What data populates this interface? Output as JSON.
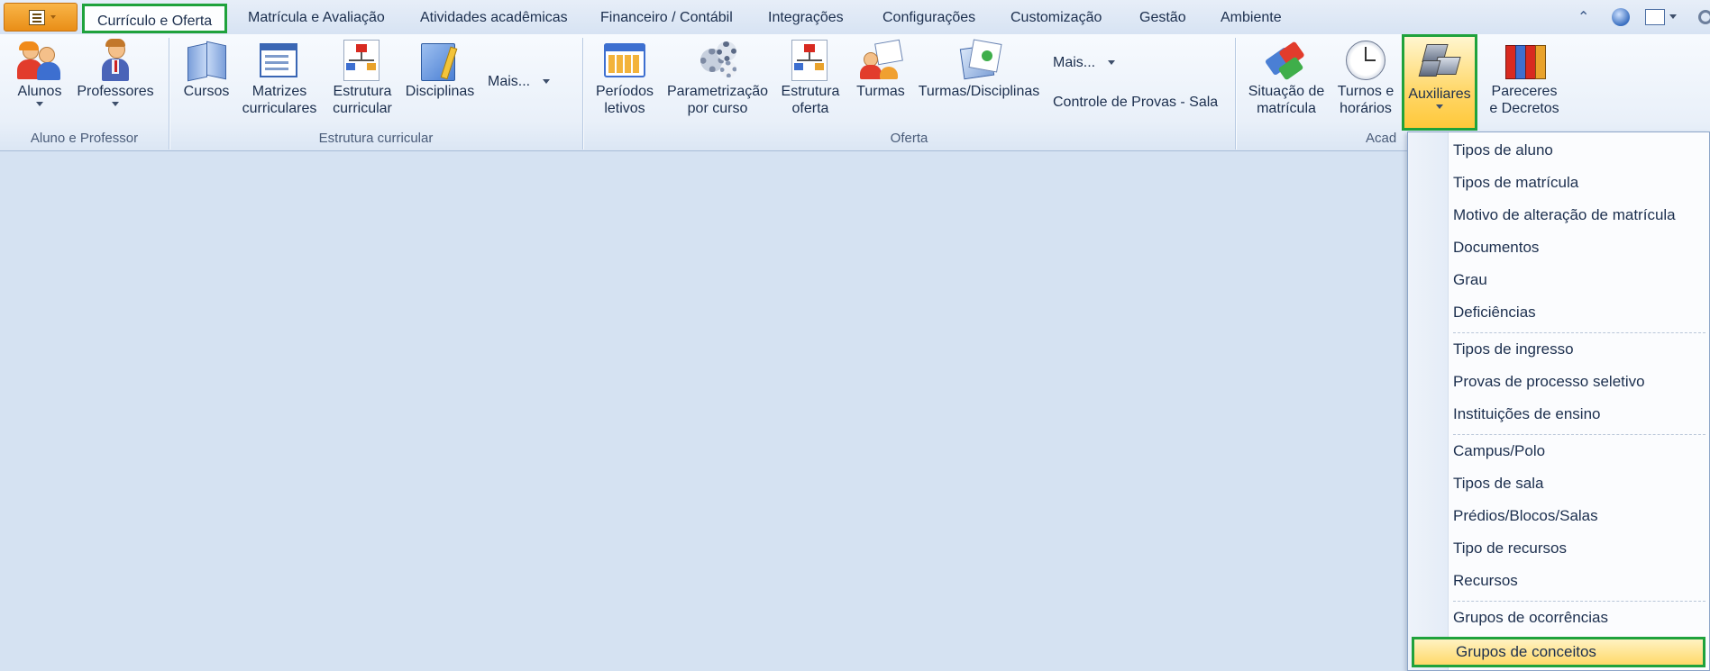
{
  "tabs": {
    "items": [
      {
        "label": "Currículo e Oferta"
      },
      {
        "label": "Matrícula e Avaliação"
      },
      {
        "label": "Atividades acadêmicas"
      },
      {
        "label": "Financeiro / Contábil"
      },
      {
        "label": "Integrações"
      },
      {
        "label": "Configurações"
      },
      {
        "label": "Customização"
      },
      {
        "label": "Gestão"
      },
      {
        "label": "Ambiente"
      }
    ],
    "active_index": 0
  },
  "quick_access": {
    "up_glyph": "⌃",
    "icons": [
      "collapse-ribbon-icon",
      "help-globe-icon",
      "window-layout-icon",
      "settings-gear-icon"
    ]
  },
  "ribbon": {
    "groups": [
      {
        "label": "Aluno e Professor",
        "buttons": [
          {
            "label": "Alunos",
            "icon": "students-icon",
            "has_dropdown": true
          },
          {
            "label": "Professores",
            "icon": "teacher-icon",
            "has_dropdown": true
          }
        ]
      },
      {
        "label": "Estrutura curricular",
        "buttons": [
          {
            "label": "Cursos",
            "icon": "book-icon"
          },
          {
            "label_lines": [
              "Matrizes",
              "curriculares"
            ],
            "icon": "curriculum-matrix-icon"
          },
          {
            "label_lines": [
              "Estrutura",
              "curricular"
            ],
            "icon": "org-chart-icon"
          },
          {
            "label": "Disciplinas",
            "icon": "folder-pencil-icon"
          }
        ],
        "more_label": "Mais..."
      },
      {
        "label": "Oferta",
        "buttons": [
          {
            "label_lines": [
              "Períodos",
              "letivos"
            ],
            "icon": "calendar-icon"
          },
          {
            "label_lines": [
              "Parametrização",
              "por curso"
            ],
            "icon": "gears-icon"
          },
          {
            "label_lines": [
              "Estrutura",
              "oferta"
            ],
            "icon": "org-chart-icon"
          },
          {
            "label": "Turmas",
            "icon": "class-group-icon"
          },
          {
            "label": "Turmas/Disciplinas",
            "icon": "class-subjects-icon"
          }
        ],
        "more_label": "Mais...",
        "extra_label": "Controle de Provas - Sala"
      },
      {
        "label": "Acad",
        "buttons": [
          {
            "label_lines": [
              "Situação de",
              "matrícula"
            ],
            "icon": "enrollment-status-icon"
          },
          {
            "label_lines": [
              "Turnos e",
              "horários"
            ],
            "icon": "clock-icon"
          },
          {
            "label": "Auxiliares",
            "icon": "auxiliary-tools-icon",
            "has_dropdown": true,
            "active": true
          },
          {
            "label_lines": [
              "Pareceres",
              "e Decretos"
            ],
            "icon": "binders-icon"
          }
        ]
      }
    ]
  },
  "dropdown_menu": {
    "sections": [
      [
        "Tipos de aluno",
        "Tipos de matrícula",
        "Motivo de alteração de matrícula",
        "Documentos",
        "Grau",
        "Deficiências"
      ],
      [
        "Tipos de ingresso",
        "Provas de processo seletivo",
        "Instituições de ensino"
      ],
      [
        "Campus/Polo",
        "Tipos de sala",
        "Prédios/Blocos/Salas",
        "Tipo de recursos",
        "Recursos"
      ],
      [
        "Grupos de ocorrências",
        "Grupos de conceitos"
      ]
    ],
    "highlighted_item": "Grupos de conceitos"
  },
  "colors": {
    "highlight_border": "#1fa23c",
    "workspace_bg": "#d5e2f2",
    "app_button": "#f0a030",
    "active_button": "#ffd768"
  }
}
